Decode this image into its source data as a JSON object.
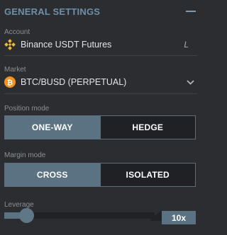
{
  "header": {
    "title": "GENERAL SETTINGS",
    "collapse_icon": "minus-icon"
  },
  "account": {
    "label": "Account",
    "value": "Binance USDT Futures",
    "suffix": "L",
    "icon": "binance-logo-icon"
  },
  "market": {
    "label": "Market",
    "value": "BTC/BUSD (PERPETUAL)",
    "icon": "bitcoin-icon"
  },
  "position_mode": {
    "label": "Position mode",
    "options": [
      "ONE-WAY",
      "HEDGE"
    ],
    "selected": "ONE-WAY"
  },
  "margin_mode": {
    "label": "Margin mode",
    "options": [
      "CROSS",
      "ISOLATED"
    ],
    "selected": "CROSS"
  },
  "leverage": {
    "label": "Leverage",
    "value_label": "10x",
    "slider_fraction": 0.1
  },
  "colors": {
    "accent": "#5a7282",
    "binance": "#f3ba2f",
    "bitcoin": "#f7931a",
    "background": "#2b2d30"
  }
}
